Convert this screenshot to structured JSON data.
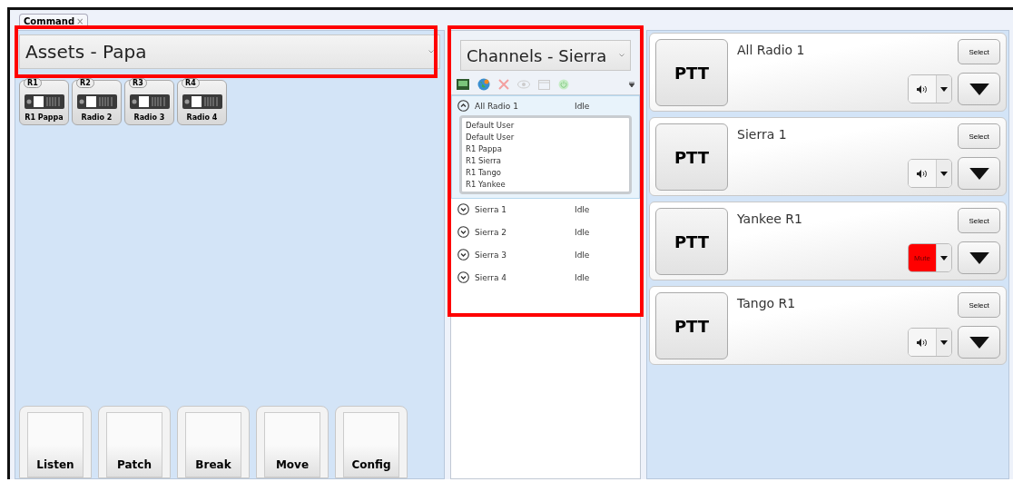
{
  "tab": {
    "label": "Command",
    "close": "×"
  },
  "assets": {
    "title": "Assets - Papa",
    "radios": [
      {
        "badge": "R1",
        "name": "R1 Pappa"
      },
      {
        "badge": "R2",
        "name": "Radio 2"
      },
      {
        "badge": "R3",
        "name": "Radio 3"
      },
      {
        "badge": "R4",
        "name": "Radio 4"
      }
    ],
    "actions": [
      "Listen",
      "Patch",
      "Break",
      "Move",
      "Config"
    ]
  },
  "channels": {
    "title": "Channels - Sierra",
    "items": [
      {
        "name": "All Radio 1",
        "status": "Idle",
        "expanded": true,
        "members": [
          "Default User",
          "Default User",
          "R1 Pappa",
          "R1 Sierra",
          "R1 Tango",
          "R1 Yankee"
        ]
      },
      {
        "name": "Sierra 1",
        "status": "Idle",
        "expanded": false
      },
      {
        "name": "Sierra 2",
        "status": "Idle",
        "expanded": false
      },
      {
        "name": "Sierra 3",
        "status": "Idle",
        "expanded": false
      },
      {
        "name": "Sierra 4",
        "status": "Idle",
        "expanded": false
      }
    ]
  },
  "cards": [
    {
      "name": "All Radio 1",
      "ptt": "PTT",
      "select": "Select",
      "muted": false
    },
    {
      "name": "Sierra 1",
      "ptt": "PTT",
      "select": "Select",
      "muted": false
    },
    {
      "name": "Yankee R1",
      "ptt": "PTT",
      "select": "Select",
      "muted": true,
      "mute_label": "Mute"
    },
    {
      "name": "Tango R1",
      "ptt": "PTT",
      "select": "Select",
      "muted": false
    }
  ]
}
